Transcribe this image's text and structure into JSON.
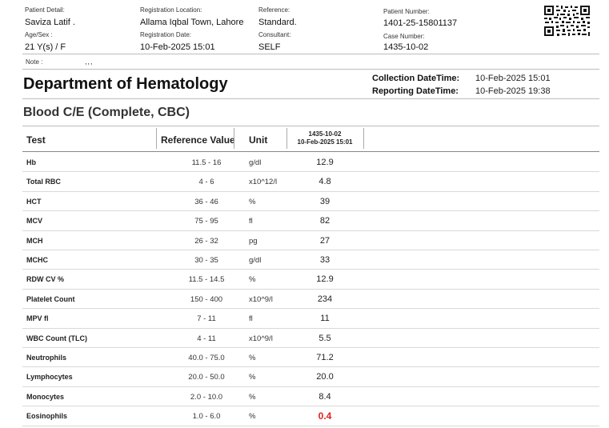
{
  "patient": {
    "detail_label": "Patient Detail:",
    "name": "Saviza Latif .",
    "age_sex_label": "Age/Sex :",
    "age_sex": "21 Y(s) / F",
    "reg_location_label": "Registration Location:",
    "reg_location": "Allama Iqbal Town, Lahore",
    "reg_date_label": "Registration Date:",
    "reg_date": "10-Feb-2025 15:01",
    "reference_label": "Reference:",
    "reference": "Standard.",
    "consultant_label": "Consultant:",
    "consultant": "SELF",
    "patient_number_label": "Patient Number:",
    "patient_number": "1401-25-15801137",
    "case_number_label": "Case Number:",
    "case_number": "1435-10-02",
    "note_label": "Note :",
    "note_value": ",,,"
  },
  "department": {
    "title": "Department of Hematology",
    "collection_label": "Collection DateTime:",
    "collection_value": "10-Feb-2025 15:01",
    "reporting_label": "Reporting DateTime:",
    "reporting_value": "10-Feb-2025 19:38"
  },
  "report": {
    "title": "Blood C/E (Complete, CBC)",
    "columns": {
      "test": "Test",
      "reference": "Reference Value",
      "unit": "Unit",
      "result_case": "1435-10-02",
      "result_date": "10-Feb-2025 15:01"
    },
    "rows": [
      {
        "test": "Hb",
        "ref": "11.5  -  16",
        "unit": "g/dl",
        "result": "12.9",
        "flag": false
      },
      {
        "test": "Total RBC",
        "ref": "4  -  6",
        "unit": "x10^12/l",
        "result": "4.8",
        "flag": false
      },
      {
        "test": "HCT",
        "ref": "36  -  46",
        "unit": "%",
        "result": "39",
        "flag": false
      },
      {
        "test": "MCV",
        "ref": "75  -  95",
        "unit": "fl",
        "result": "82",
        "flag": false
      },
      {
        "test": "MCH",
        "ref": "26  -  32",
        "unit": "pg",
        "result": "27",
        "flag": false
      },
      {
        "test": "MCHC",
        "ref": "30  -  35",
        "unit": "g/dl",
        "result": "33",
        "flag": false
      },
      {
        "test": "RDW CV %",
        "ref": "11.5  -  14.5",
        "unit": "%",
        "result": "12.9",
        "flag": false
      },
      {
        "test": "Platelet Count",
        "ref": "150  -  400",
        "unit": "x10^9/l",
        "result": "234",
        "flag": false
      },
      {
        "test": "MPV fl",
        "ref": "7  -  11",
        "unit": "fl",
        "result": "11",
        "flag": false
      },
      {
        "test": "WBC Count (TLC)",
        "ref": "4  -  11",
        "unit": "x10^9/l",
        "result": "5.5",
        "flag": false
      },
      {
        "test": "Neutrophils",
        "ref": "40.0  -  75.0",
        "unit": "%",
        "result": "71.2",
        "flag": false
      },
      {
        "test": "Lymphocytes",
        "ref": "20.0  -  50.0",
        "unit": "%",
        "result": "20.0",
        "flag": false
      },
      {
        "test": "Monocytes",
        "ref": "2.0  -  10.0",
        "unit": "%",
        "result": "8.4",
        "flag": false
      },
      {
        "test": "Eosinophils",
        "ref": "1.0  -  6.0",
        "unit": "%",
        "result": "0.4",
        "flag": true
      }
    ]
  },
  "colors": {
    "flag": "#e02020",
    "rule": "#bbbbbb"
  },
  "qr_icon": "qr-code-icon"
}
